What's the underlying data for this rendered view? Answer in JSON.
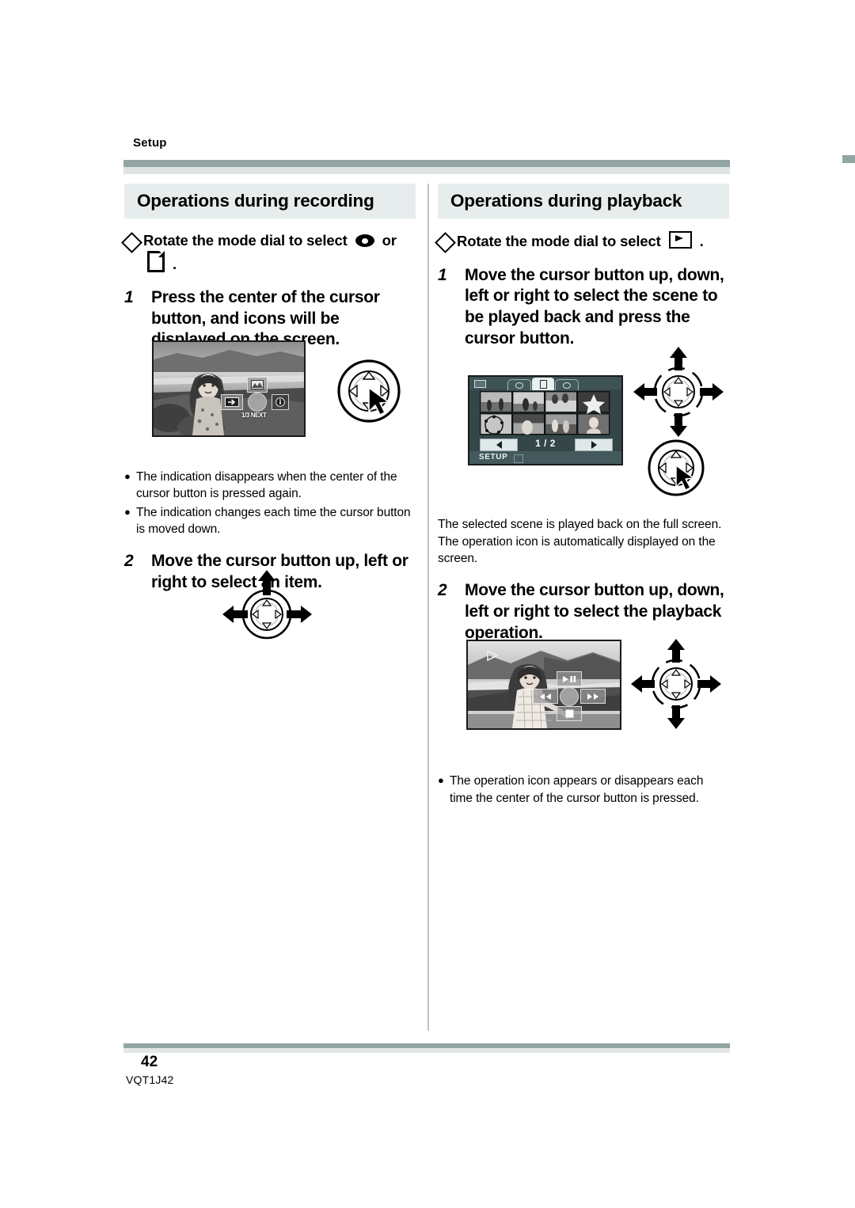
{
  "page": {
    "running_head": "Setup",
    "page_number": "42",
    "doc_code": "VQT1J42"
  },
  "left_column": {
    "section_title": "Operations during recording",
    "lead_in": {
      "prefix": "Rotate the mode dial to select",
      "icon_1": "tape-mode-icon",
      "middle": "or",
      "icon_2": "card-mode-icon",
      "suffix": "."
    },
    "steps": [
      {
        "number": "1",
        "text": "Press the center of the cursor button, and icons will be displayed on the screen."
      },
      {
        "number": "2",
        "text": "Move the cursor button up, left or right to select an item."
      }
    ],
    "bullets": [
      "The indication disappears when the center of the cursor button is pressed again.",
      "The indication changes each time the cursor button is moved down."
    ],
    "figure_1": {
      "name": "lcd-recording-screen",
      "osd": {
        "top_icon": "scene-mode-icon",
        "left_icon": "exit-arrow-icon",
        "right_icon": "info-icon",
        "center_icon": "cursor-center-icon",
        "next_label": "1/3 NEXT"
      },
      "cursor_diagram": "cursor-press-center"
    },
    "figure_2": {
      "name": "cursor-diagram-up-left-right",
      "arrows": [
        "up",
        "left",
        "right"
      ]
    }
  },
  "right_column": {
    "section_title": "Operations during playback",
    "lead_in": {
      "prefix": "Rotate the mode dial to select",
      "icon_1": "playback-mode-icon",
      "suffix": "."
    },
    "steps": [
      {
        "number": "1",
        "text": "Move the cursor button up, down, left or right to select the scene to be played back and press the cursor button."
      },
      {
        "number": "2",
        "text": "Move the cursor button up, down, left or right to select the playback operation."
      }
    ],
    "paragraph": "The selected scene is played back on the full screen. The operation icon is automatically displayed on the screen.",
    "bullets": [
      "The operation icon appears or disappears each time the center of the cursor button is pressed."
    ],
    "figure_1": {
      "name": "lcd-thumbnail-grid-screen",
      "osd": {
        "battery_icon": "battery-icon",
        "tab_left_icon": "tape-tab-icon",
        "tab_center_icon": "card-tab-icon",
        "tab_right_icon": "photo-tab-icon",
        "prev_icon": "previous-page-arrow",
        "next_icon": "next-page-arrow",
        "page_indicator": "1 / 2",
        "setup_label": "SETUP"
      },
      "cursor_diagram_top": "cursor-diagram-four-arrows",
      "cursor_diagram_bottom": "cursor-press-center"
    },
    "figure_2": {
      "name": "lcd-playback-screen",
      "osd": {
        "status_icon": "play-triangle-icon",
        "play_pause_icon": "play-pause-icon",
        "rewind_icon": "rewind-icon",
        "forward_icon": "fast-forward-icon",
        "stop_icon": "stop-icon",
        "center_icon": "cursor-center-icon"
      },
      "cursor_diagram": "cursor-diagram-four-arrows"
    }
  },
  "colors": {
    "rule": "#93a5a3",
    "rule_shadow": "#dfe4e3",
    "section_bg": "#e7ecec",
    "divider": "#b9c3c2",
    "lcd_dark": "#2f3f42",
    "lcd_panel": "#46595c"
  }
}
